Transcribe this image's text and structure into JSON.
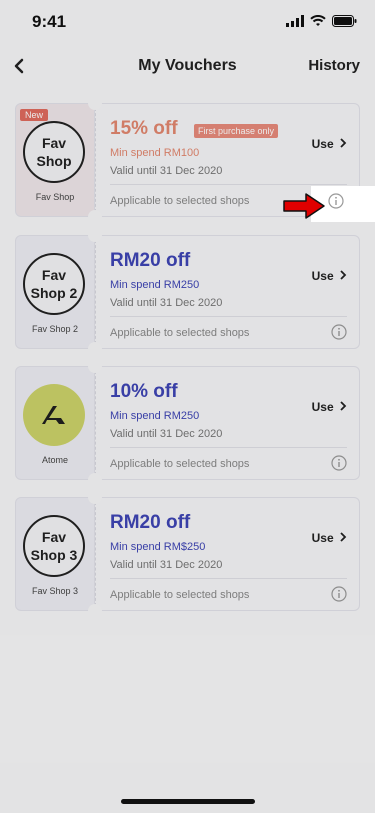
{
  "status": {
    "time": "9:41"
  },
  "nav": {
    "back_icon": "chevron-left-icon",
    "title": "My Vouchers",
    "history": "History"
  },
  "vouchers": [
    {
      "badge": "New",
      "logo_text": "Fav\nShop",
      "shop_name": "Fav Shop",
      "amount": "15% off",
      "tag": "First purchase only",
      "min_spend": "Min spend RM100",
      "valid": "Valid until 31 Dec 2020",
      "use_label": "Use",
      "applicable": "Applicable to selected shops",
      "color": "#e2876f"
    },
    {
      "logo_text": "Fav\nShop 2",
      "shop_name": "Fav Shop 2",
      "amount": "RM20 off",
      "min_spend": "Min spend RM250",
      "valid": "Valid until 31 Dec 2020",
      "use_label": "Use",
      "applicable": "Applicable to selected shops",
      "color": "#3e45b5"
    },
    {
      "logo_icon": "atome-logo-icon",
      "shop_name": "Atome",
      "amount": "10% off",
      "min_spend": "Min spend RM250",
      "valid": "Valid until 31 Dec 2020",
      "use_label": "Use",
      "applicable": "Applicable to selected shops",
      "color": "#3e45b5"
    },
    {
      "logo_text": "Fav\nShop 3",
      "shop_name": "Fav Shop 3",
      "amount": "RM20 off",
      "min_spend": "Min spend RM$250",
      "valid": "Valid until 31 Dec 2020",
      "use_label": "Use",
      "applicable": "Applicable to selected shops",
      "color": "#3e45b5"
    }
  ],
  "annotation": {
    "arrow_color": "#e00000",
    "target": "info-icon"
  }
}
